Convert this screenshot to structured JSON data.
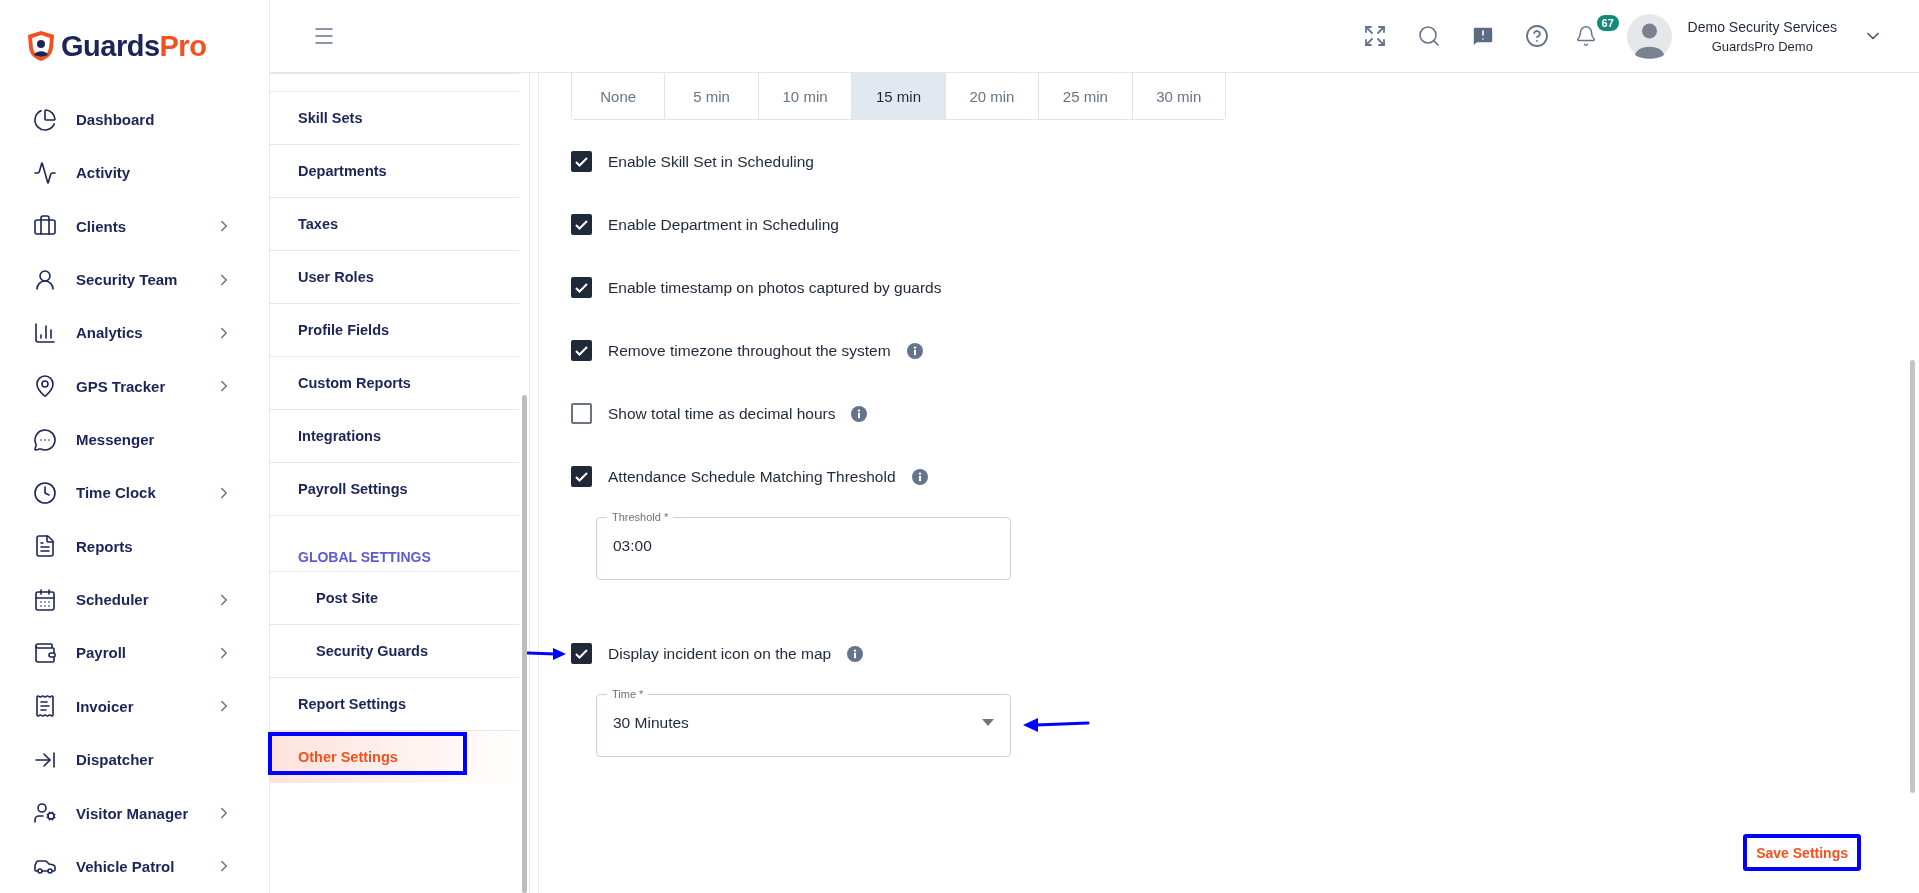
{
  "logo": {
    "parts": [
      "Guards",
      "Pro"
    ]
  },
  "nav": [
    {
      "label": "Dashboard",
      "expandable": false
    },
    {
      "label": "Activity",
      "expandable": false
    },
    {
      "label": "Clients",
      "expandable": true
    },
    {
      "label": "Security Team",
      "expandable": true
    },
    {
      "label": "Analytics",
      "expandable": true
    },
    {
      "label": "GPS Tracker",
      "expandable": true
    },
    {
      "label": "Messenger",
      "expandable": false
    },
    {
      "label": "Time Clock",
      "expandable": true
    },
    {
      "label": "Reports",
      "expandable": false
    },
    {
      "label": "Scheduler",
      "expandable": true
    },
    {
      "label": "Payroll",
      "expandable": true
    },
    {
      "label": "Invoicer",
      "expandable": true
    },
    {
      "label": "Dispatcher",
      "expandable": false
    },
    {
      "label": "Visitor Manager",
      "expandable": true
    },
    {
      "label": "Vehicle Patrol",
      "expandable": true
    }
  ],
  "header": {
    "notifications": "67",
    "user": {
      "name": "Demo Security Services",
      "org": "GuardsPro Demo"
    }
  },
  "settings_menu": [
    {
      "kind": "item",
      "label": "Skill Sets",
      "selected": false
    },
    {
      "kind": "item",
      "label": "Departments",
      "selected": false
    },
    {
      "kind": "item",
      "label": "Taxes",
      "selected": false
    },
    {
      "kind": "item",
      "label": "User Roles",
      "selected": false
    },
    {
      "kind": "item",
      "label": "Profile Fields",
      "selected": false
    },
    {
      "kind": "item",
      "label": "Custom Reports",
      "selected": false
    },
    {
      "kind": "item",
      "label": "Integrations",
      "selected": false
    },
    {
      "kind": "item",
      "label": "Payroll Settings",
      "selected": false
    },
    {
      "kind": "heading",
      "label": "GLOBAL SETTINGS",
      "children": [
        {
          "label": "Post Site",
          "selected": false
        },
        {
          "label": "Security Guards",
          "selected": false
        }
      ]
    },
    {
      "kind": "item",
      "label": "Report Settings",
      "selected": false
    },
    {
      "kind": "item",
      "label": "Other Settings",
      "selected": true,
      "highlighted": true
    }
  ],
  "intervals": [
    {
      "label": "None",
      "selected": false
    },
    {
      "label": "5 min",
      "selected": false
    },
    {
      "label": "10 min",
      "selected": false
    },
    {
      "label": "15 min",
      "selected": true
    },
    {
      "label": "20 min",
      "selected": false
    },
    {
      "label": "25 min",
      "selected": false
    },
    {
      "label": "30 min",
      "selected": false
    }
  ],
  "options": [
    {
      "label": "Enable Skill Set in Scheduling",
      "checked": true
    },
    {
      "label": "Enable Department in Scheduling",
      "checked": true
    },
    {
      "label": "Enable timestamp on photos captured by guards",
      "checked": true
    },
    {
      "label": "Remove timezone throughout the system",
      "checked": true,
      "info": true
    },
    {
      "label": "Show total time as decimal hours",
      "checked": false,
      "info": true
    },
    {
      "label": "Attendance Schedule Matching Threshold",
      "checked": true,
      "info": true,
      "field": {
        "kind": "text",
        "label": "Threshold *",
        "value": "03:00"
      }
    },
    {
      "label": "Display incident icon on the map",
      "checked": true,
      "info": true,
      "arrow": true,
      "field": {
        "kind": "select",
        "label": "Time *",
        "value": "30 Minutes",
        "arrow": true
      }
    }
  ],
  "save_button": {
    "label": "Save Settings",
    "highlighted": true
  }
}
